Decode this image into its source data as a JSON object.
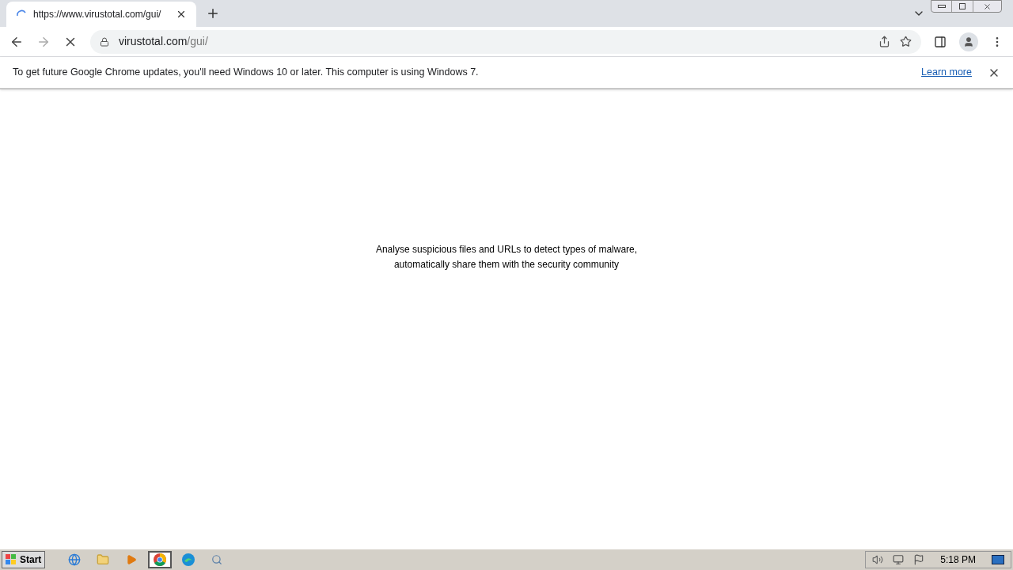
{
  "browser": {
    "tab": {
      "title": "https://www.virustotal.com/gui/",
      "loading": true
    },
    "address": {
      "host": "virustotal.com",
      "path": "/gui/"
    },
    "infobar": {
      "message": "To get future Google Chrome updates, you'll need Windows 10 or later. This computer is using Windows 7.",
      "link": "Learn more"
    }
  },
  "page": {
    "lines": [
      "Analyse suspicious files and URLs to detect types of malware,",
      "automatically share them with the security community"
    ]
  },
  "taskbar": {
    "start": "Start",
    "items": [
      {
        "kind": "ie",
        "selected": false
      },
      {
        "kind": "folder",
        "selected": false
      },
      {
        "kind": "media",
        "selected": false
      },
      {
        "kind": "chrome",
        "selected": true
      },
      {
        "kind": "edge",
        "selected": false
      },
      {
        "kind": "search",
        "selected": false
      }
    ],
    "clock": "5:18 PM"
  }
}
